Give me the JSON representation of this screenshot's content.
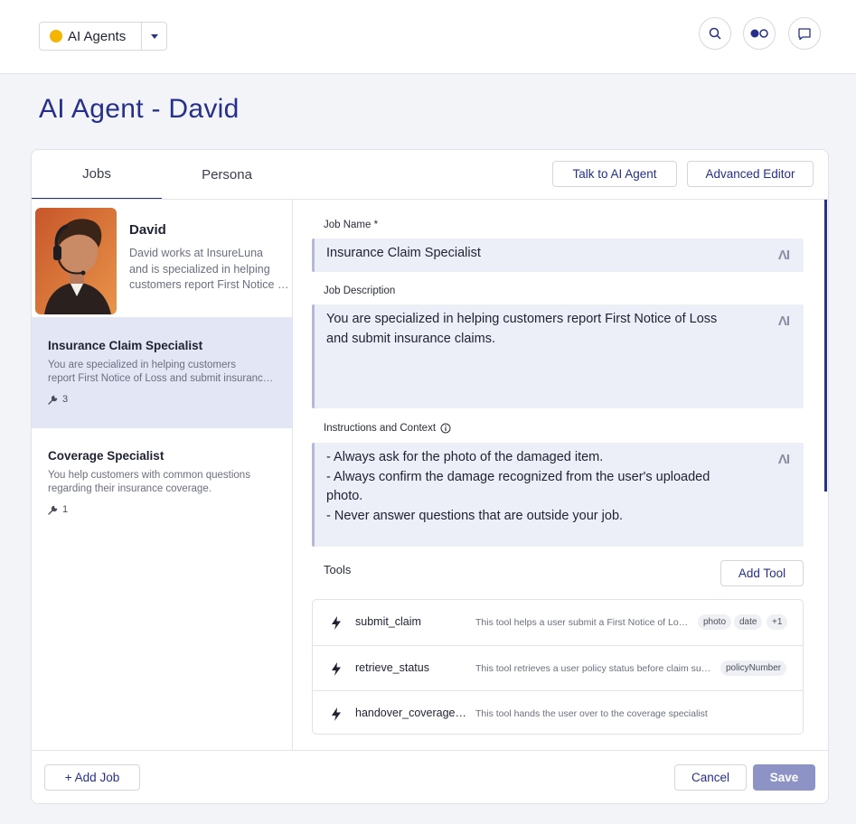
{
  "header": {
    "workspace_label": "AI Agents",
    "workspace_dot_color": "#f4b400",
    "icons": [
      "search-icon",
      "toggle-icon",
      "chat-icon"
    ]
  },
  "page": {
    "title": "AI Agent - David"
  },
  "tabs": [
    {
      "label": "Jobs",
      "active": true
    },
    {
      "label": "Persona",
      "active": false
    }
  ],
  "actions": {
    "talk_label": "Talk to AI Agent",
    "advanced_label": "Advanced Editor"
  },
  "agent": {
    "name": "David",
    "desc_lines": [
      "David works at InsureLuna",
      "and is specialized in helping",
      "customers report First Notice of Loss"
    ]
  },
  "jobs": [
    {
      "title": "Insurance Claim Specialist",
      "desc_lines": [
        "You are specialized in helping customers",
        "report First Notice of Loss and submit insurance claims."
      ],
      "tool_count": "3",
      "selected": true
    },
    {
      "title": "Coverage Specialist",
      "desc_lines": [
        "You help customers with common questions",
        "regarding their insurance coverage."
      ],
      "tool_count": "1",
      "selected": false
    }
  ],
  "form": {
    "job_name_label": "Job Name *",
    "job_name_value": "Insurance Claim Specialist",
    "job_desc_label": "Job Description",
    "job_desc_lines": [
      "You are specialized in helping customers report First Notice of Loss",
      "and submit insurance claims."
    ],
    "instructions_label": "Instructions and Context",
    "instructions_lines": [
      "- Always ask for the photo of the damaged item.",
      "- Always confirm the damage recognized from the user's uploaded",
      "photo.",
      "- Never answer questions that are outside your job."
    ],
    "ai_mark": "ΛI"
  },
  "tools": {
    "label": "Tools",
    "add_label": "Add Tool",
    "rows": [
      {
        "name": "submit_claim",
        "desc": "This tool helps a user submit a First Notice of Loss claim",
        "tags": [
          "photo",
          "date",
          "+1"
        ]
      },
      {
        "name": "retrieve_status",
        "desc": "This tool retrieves a user policy status before claim submission",
        "tags": [
          "policyNumber"
        ]
      },
      {
        "name": "handover_coverage_specialist",
        "desc": "This tool hands the user over to the coverage specialist",
        "tags": []
      }
    ]
  },
  "footer": {
    "add_job_label": "+ Add Job",
    "cancel_label": "Cancel",
    "save_label": "Save"
  },
  "colors": {
    "accent": "#26308a",
    "selected_bg": "#e3e6f4",
    "field_bg": "#eceef8",
    "save_bg": "#8d94c5"
  }
}
